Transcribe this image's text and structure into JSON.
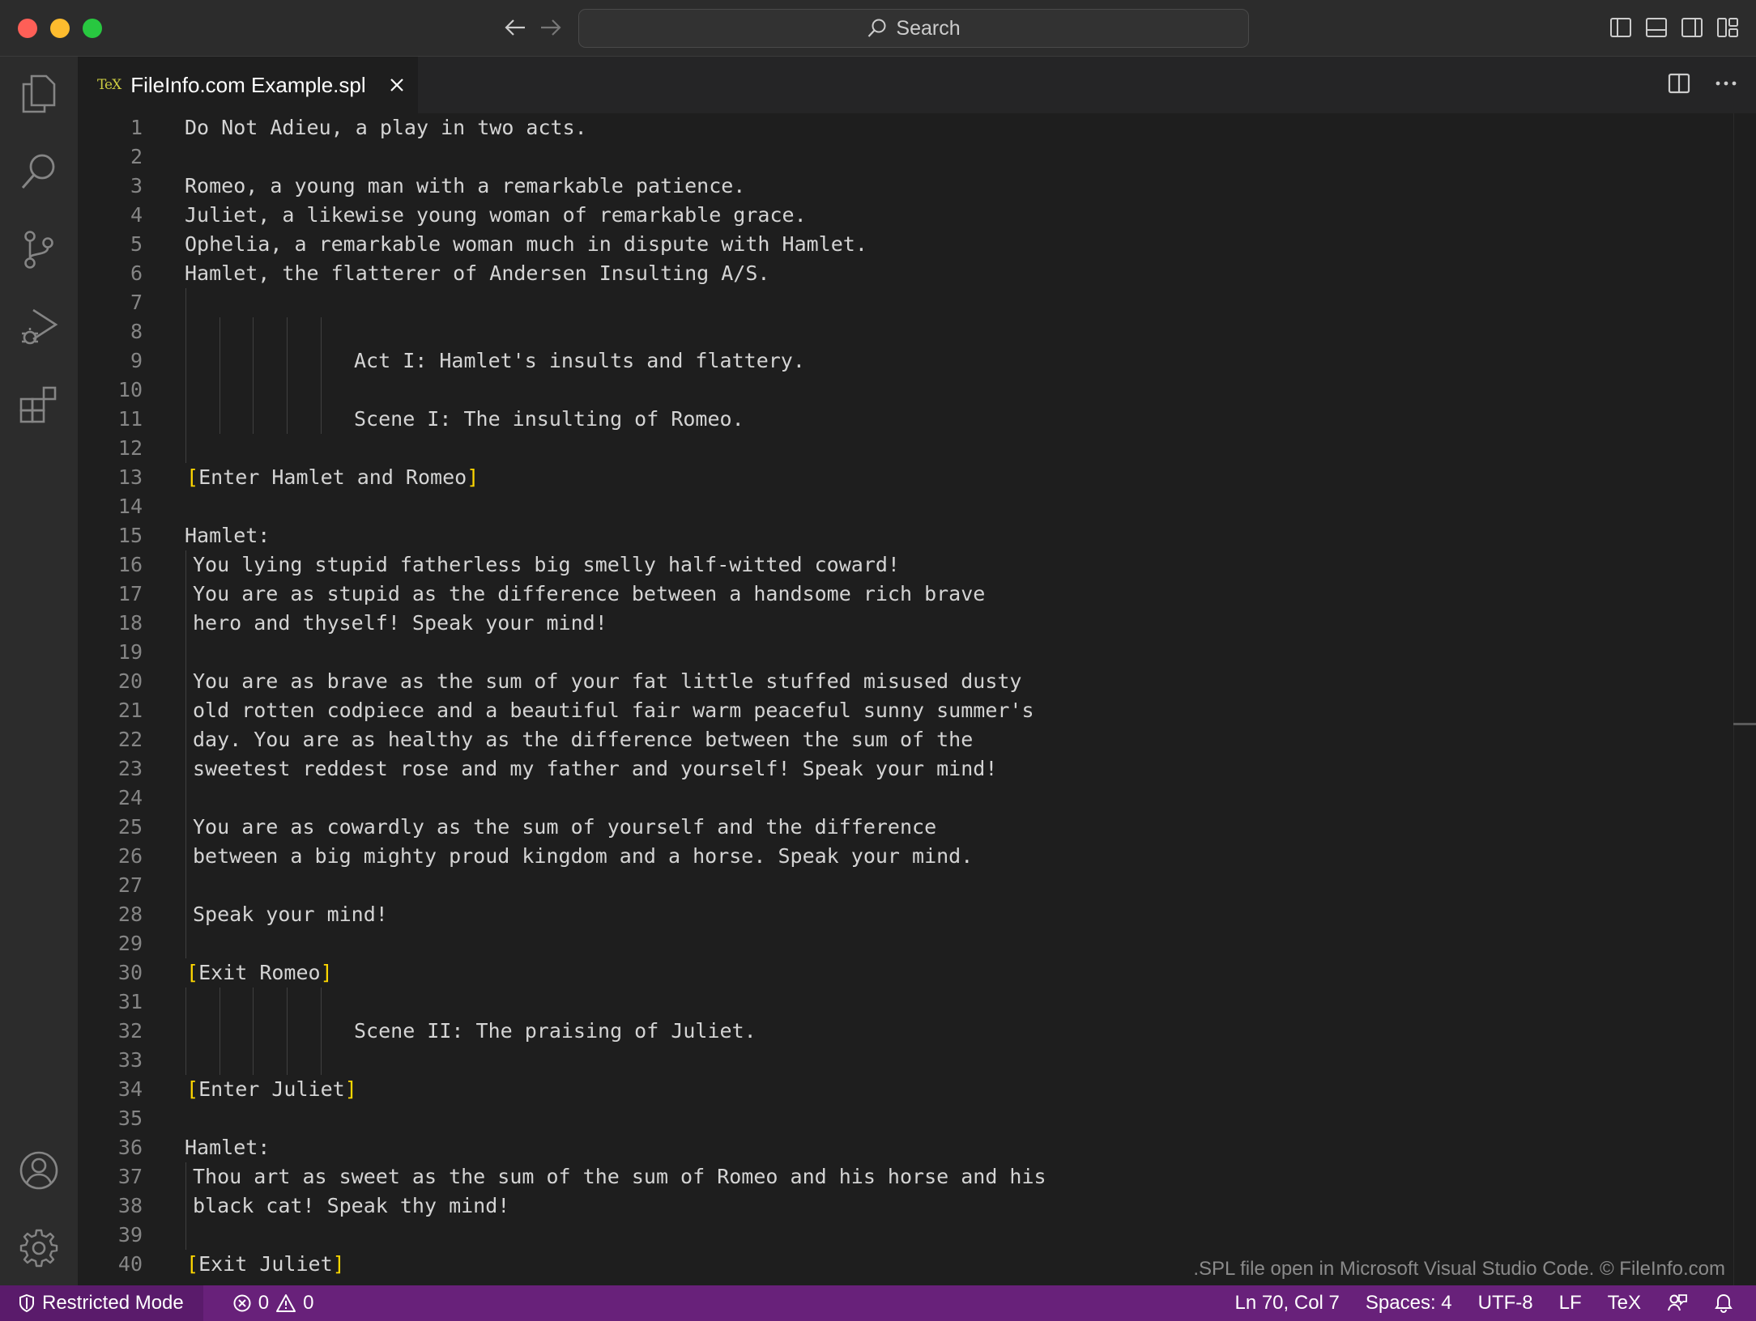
{
  "window": {
    "search_placeholder": "Search"
  },
  "tab": {
    "file_icon": "TeX",
    "label": "FileInfo.com Example.spl"
  },
  "editor": {
    "lines": [
      {
        "n": "1",
        "text": "Do Not Adieu, a play in two acts."
      },
      {
        "n": "2",
        "text": ""
      },
      {
        "n": "3",
        "text": "Romeo, a young man with a remarkable patience."
      },
      {
        "n": "4",
        "text": "Juliet, a likewise young woman of remarkable grace."
      },
      {
        "n": "5",
        "text": "Ophelia, a remarkable woman much in dispute with Hamlet."
      },
      {
        "n": "6",
        "text": "Hamlet, the flatterer of Andersen Insulting A/S."
      },
      {
        "n": "7",
        "text": ""
      },
      {
        "n": "8",
        "text": ""
      },
      {
        "n": "9",
        "text": "Act I: Hamlet's insults and flattery."
      },
      {
        "n": "10",
        "text": ""
      },
      {
        "n": "11",
        "text": "Scene I: The insulting of Romeo."
      },
      {
        "n": "12",
        "text": ""
      },
      {
        "n": "13",
        "text": "Enter Hamlet and Romeo"
      },
      {
        "n": "14",
        "text": ""
      },
      {
        "n": "15",
        "text": "Hamlet:"
      },
      {
        "n": "16",
        "text": "You lying stupid fatherless big smelly half-witted coward!"
      },
      {
        "n": "17",
        "text": "You are as stupid as the difference between a handsome rich brave"
      },
      {
        "n": "18",
        "text": "hero and thyself! Speak your mind!"
      },
      {
        "n": "19",
        "text": ""
      },
      {
        "n": "20",
        "text": "You are as brave as the sum of your fat little stuffed misused dusty"
      },
      {
        "n": "21",
        "text": "old rotten codpiece and a beautiful fair warm peaceful sunny summer's"
      },
      {
        "n": "22",
        "text": "day. You are as healthy as the difference between the sum of the"
      },
      {
        "n": "23",
        "text": "sweetest reddest rose and my father and yourself! Speak your mind!"
      },
      {
        "n": "24",
        "text": ""
      },
      {
        "n": "25",
        "text": "You are as cowardly as the sum of yourself and the difference"
      },
      {
        "n": "26",
        "text": "between a big mighty proud kingdom and a horse. Speak your mind."
      },
      {
        "n": "27",
        "text": ""
      },
      {
        "n": "28",
        "text": "Speak your mind!"
      },
      {
        "n": "29",
        "text": ""
      },
      {
        "n": "30",
        "text": "Exit Romeo"
      },
      {
        "n": "31",
        "text": ""
      },
      {
        "n": "32",
        "text": "Scene II: The praising of Juliet."
      },
      {
        "n": "33",
        "text": ""
      },
      {
        "n": "34",
        "text": "Enter Juliet"
      },
      {
        "n": "35",
        "text": ""
      },
      {
        "n": "36",
        "text": "Hamlet:"
      },
      {
        "n": "37",
        "text": "Thou art as sweet as the sum of the sum of Romeo and his horse and his"
      },
      {
        "n": "38",
        "text": "black cat! Speak thy mind!"
      },
      {
        "n": "39",
        "text": ""
      },
      {
        "n": "40",
        "text": "Exit Juliet"
      }
    ],
    "bracket_open": "[",
    "bracket_close": "]",
    "watermark": ".SPL file open in Microsoft Visual Studio Code. © FileInfo.com"
  },
  "statusbar": {
    "restricted_mode": "Restricted Mode",
    "errors": "0",
    "warnings": "0",
    "position": "Ln 70, Col 7",
    "spaces": "Spaces: 4",
    "encoding": "UTF-8",
    "eol": "LF",
    "language": "TeX"
  },
  "colors": {
    "statusbar": "#68217a",
    "bracket": "#ffd700",
    "tex_icon": "#cbcb41"
  },
  "icons": [
    "explorer-icon",
    "search-icon",
    "source-control-icon",
    "run-debug-icon",
    "extensions-icon",
    "accounts-icon",
    "settings-gear-icon",
    "split-editor-icon",
    "more-actions-icon",
    "shield-icon",
    "error-icon",
    "warning-icon",
    "feedback-icon",
    "bell-icon"
  ]
}
